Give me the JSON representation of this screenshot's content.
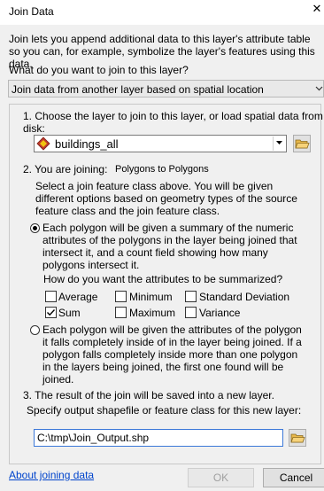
{
  "window": {
    "title": "Join Data"
  },
  "intro_text": "Join lets you append additional data to this layer's attribute table so you can, for example, symbolize the layer's features using this data.",
  "question": "What do you want to join to this layer?",
  "join_type": {
    "selected": "Join data from another layer based on spatial location"
  },
  "step1": {
    "label": "1.  Choose the layer to join to this layer, or load spatial data from disk:",
    "layer_selected": "buildings_all"
  },
  "step2": {
    "label": "2.  You are joining:",
    "joining_value": "Polygons to Polygons",
    "description": "Select a join feature class above.  You will be given different options based on geometry types of the source feature class and the join feature class.",
    "option_summary": {
      "text": "Each polygon will be given a summary of the numeric attributes of the polygons in the layer being joined that intersect it, and a count field showing how many polygons intersect it.",
      "selected": true
    },
    "summarize_question": "How do you want the attributes to be summarized?",
    "checkboxes": [
      {
        "label": "Average",
        "checked": false
      },
      {
        "label": "Minimum",
        "checked": false
      },
      {
        "label": "Standard Deviation",
        "checked": false
      },
      {
        "label": "Sum",
        "checked": true
      },
      {
        "label": "Maximum",
        "checked": false
      },
      {
        "label": "Variance",
        "checked": false
      }
    ],
    "option_inside": {
      "text": "Each polygon will be given the attributes of the polygon it falls completely inside of in the layer being joined. If a polygon falls completely inside more than one polygon in the layers being joined, the first one found will be joined.",
      "selected": false
    }
  },
  "step3": {
    "label": "3.  The result of the join will be saved into a new layer.",
    "spec_label": "Specify output shapefile or feature class for this new layer:",
    "output_path": "C:\\tmp\\Join_Output.shp"
  },
  "footer": {
    "about_link": "About joining data",
    "ok_label": "OK",
    "cancel_label": "Cancel"
  },
  "colors": {
    "link": "#0044cc",
    "focus_border": "#3c78d8",
    "folder": "#e8b84a"
  }
}
